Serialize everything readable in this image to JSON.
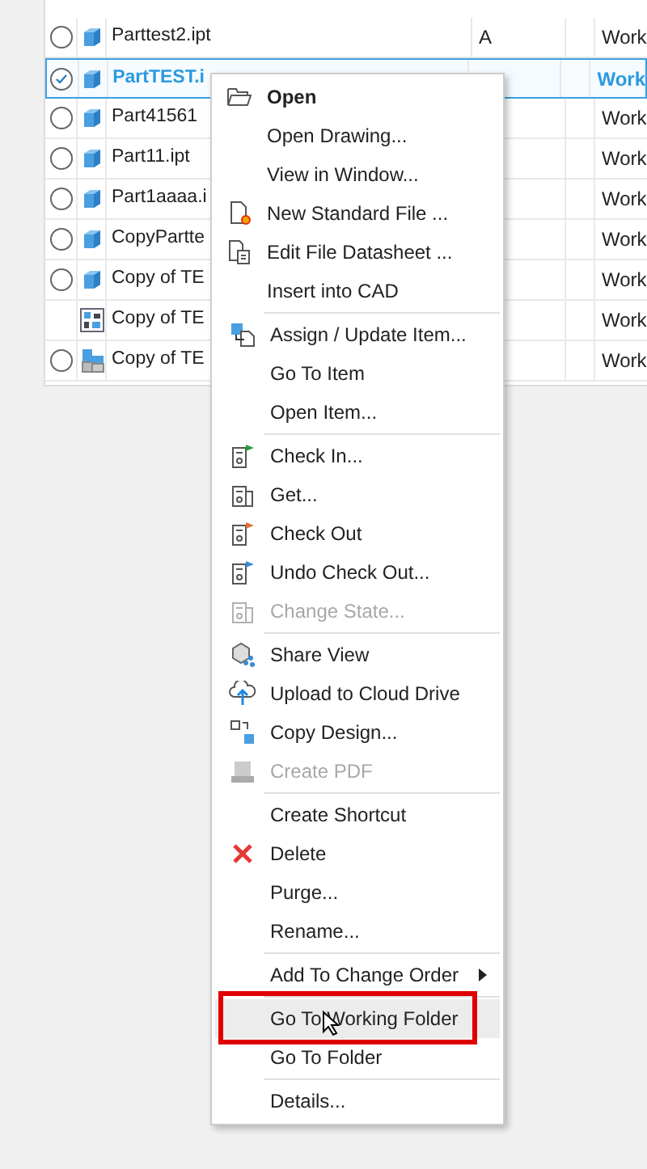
{
  "table": {
    "rows": [
      {
        "radio": true,
        "selected": false,
        "kind": "part",
        "name": "Parttest2.ipt",
        "revision": "A",
        "state": "Work"
      },
      {
        "radio": true,
        "selected": true,
        "kind": "part",
        "name": "PartTEST.i",
        "state": "Work"
      },
      {
        "radio": true,
        "selected": false,
        "kind": "part",
        "name": "Part41561",
        "state": "Work"
      },
      {
        "radio": true,
        "selected": false,
        "kind": "part",
        "name": "Part11.ipt",
        "state": "Work"
      },
      {
        "radio": true,
        "selected": false,
        "kind": "part",
        "name": "Part1aaaa.i",
        "state": "Work"
      },
      {
        "radio": true,
        "selected": false,
        "kind": "part",
        "name": "CopyPartte",
        "state": "Work"
      },
      {
        "radio": true,
        "selected": false,
        "kind": "part",
        "name": "Copy of TE",
        "state": "Work"
      },
      {
        "radio": false,
        "selected": false,
        "kind": "drawing",
        "name": "Copy of TE",
        "state": "Work"
      },
      {
        "radio": true,
        "selected": false,
        "kind": "assembly",
        "name": "Copy of TE",
        "state": "Work"
      }
    ]
  },
  "context_menu": {
    "groups": [
      [
        {
          "label": "Open",
          "bold": true,
          "disabled": false,
          "selected": false
        },
        {
          "label": "Open Drawing...",
          "bold": false,
          "disabled": false,
          "selected": false
        },
        {
          "label": "View in Window...",
          "bold": false,
          "disabled": false,
          "selected": false
        },
        {
          "label": "New Standard File ...",
          "bold": false,
          "disabled": false,
          "selected": false
        },
        {
          "label": "Edit File Datasheet ...",
          "bold": false,
          "disabled": false,
          "selected": false
        },
        {
          "label": "Insert into CAD",
          "bold": false,
          "disabled": false,
          "selected": false
        }
      ],
      [
        {
          "label": "Assign / Update Item...",
          "bold": false,
          "disabled": false,
          "selected": false
        },
        {
          "label": "Go To Item",
          "bold": false,
          "disabled": false,
          "selected": false
        },
        {
          "label": "Open Item...",
          "bold": false,
          "disabled": false,
          "selected": false
        }
      ],
      [
        {
          "label": "Check In...",
          "bold": false,
          "disabled": false,
          "selected": false
        },
        {
          "label": "Get...",
          "bold": false,
          "disabled": false,
          "selected": false
        },
        {
          "label": "Check Out",
          "bold": false,
          "disabled": false,
          "selected": false
        },
        {
          "label": "Undo Check Out...",
          "bold": false,
          "disabled": false,
          "selected": false
        },
        {
          "label": "Change State...",
          "bold": false,
          "disabled": true,
          "selected": false
        }
      ],
      [
        {
          "label": "Share View",
          "bold": false,
          "disabled": false,
          "selected": false
        },
        {
          "label": "Upload to Cloud Drive",
          "bold": false,
          "disabled": false,
          "selected": false
        },
        {
          "label": "Copy Design...",
          "bold": false,
          "disabled": false,
          "selected": false
        },
        {
          "label": "Create PDF",
          "bold": false,
          "disabled": true,
          "selected": false
        }
      ],
      [
        {
          "label": "Create Shortcut",
          "bold": false,
          "disabled": false,
          "selected": false
        },
        {
          "label": "Delete",
          "bold": false,
          "disabled": false,
          "selected": false
        },
        {
          "label": "Purge...",
          "bold": false,
          "disabled": false,
          "selected": false
        },
        {
          "label": "Rename...",
          "bold": false,
          "disabled": false,
          "selected": false
        }
      ],
      [
        {
          "label": "Add To Change Order",
          "bold": false,
          "disabled": false,
          "selected": false,
          "submenu": true
        }
      ],
      [
        {
          "label": "Go To Working Folder",
          "bold": false,
          "disabled": false,
          "selected": true,
          "highlighted": true
        },
        {
          "label": "Go To Folder",
          "bold": false,
          "disabled": false,
          "selected": false
        }
      ],
      [
        {
          "label": "Details...",
          "bold": false,
          "disabled": false,
          "selected": false
        }
      ]
    ]
  }
}
